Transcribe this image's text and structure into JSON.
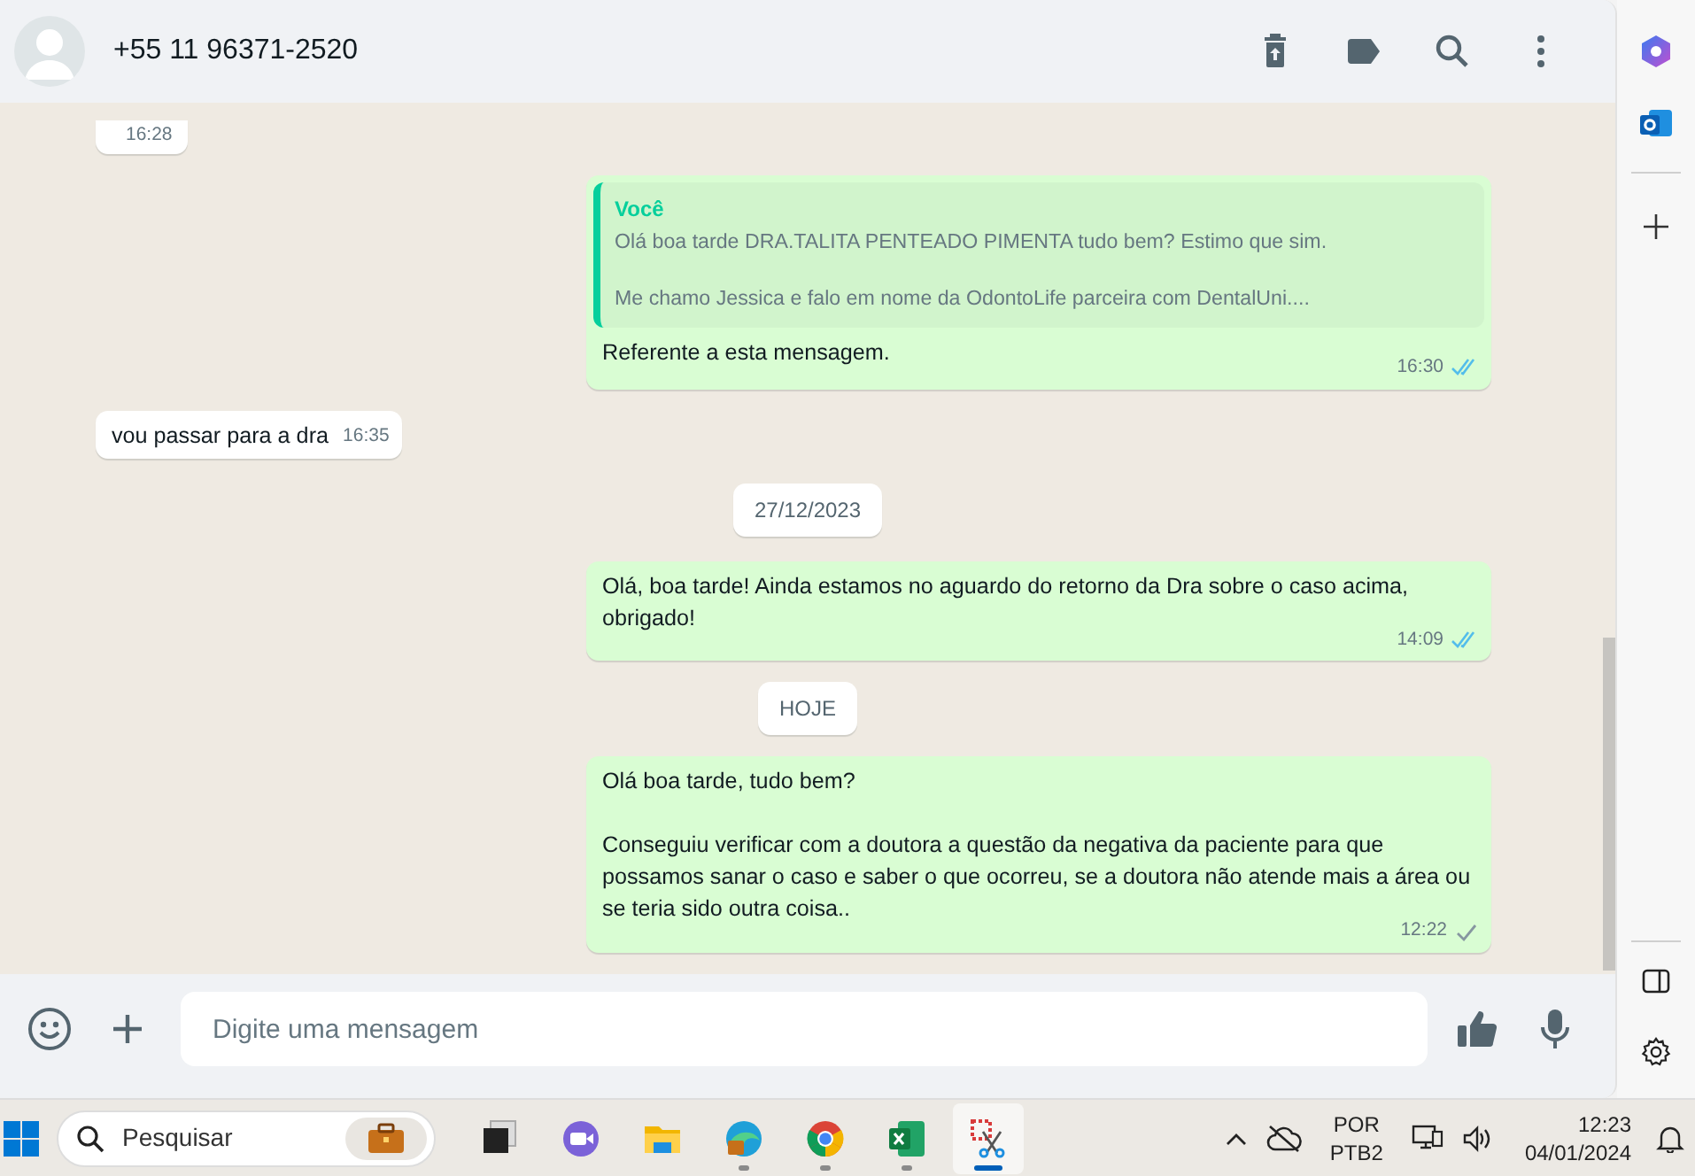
{
  "header": {
    "contact": "+55 11 96371-2520"
  },
  "messages": [
    {
      "kind": "incoming",
      "time": "16:28"
    },
    {
      "kind": "outgoing",
      "quote": {
        "author": "Você",
        "text": "Olá boa tarde DRA.TALITA PENTEADO PIMENTA tudo bem? Estimo que sim.\n\nMe chamo Jessica e falo em nome da OdontoLife parceira com DentalUni...."
      },
      "text": "Referente a esta mensagem.",
      "time": "16:30",
      "read": true
    },
    {
      "kind": "incoming",
      "text": "vou passar para a dra",
      "time": "16:35"
    },
    {
      "kind": "date",
      "text": "27/12/2023"
    },
    {
      "kind": "outgoing",
      "text": "Olá, boa tarde! Ainda estamos no aguardo do retorno da Dra sobre o caso acima, obrigado!",
      "time": "14:09",
      "read": true
    },
    {
      "kind": "date",
      "text": "HOJE"
    },
    {
      "kind": "outgoing",
      "text": "Olá boa tarde, tudo bem?\n\nConseguiu verificar com a doutora a questão da negativa da paciente para que possamos sanar o caso e saber o que ocorreu, se a doutora não atende mais a área ou se teria sido outra coisa..",
      "time": "12:22",
      "read": false
    }
  ],
  "composer": {
    "placeholder": "Digite uma mensagem"
  },
  "taskbar": {
    "search_placeholder": "Pesquisar",
    "apps": [
      {
        "kind": "taskview",
        "selected": false,
        "running": false
      },
      {
        "kind": "meet",
        "selected": false,
        "running": false
      },
      {
        "kind": "folder",
        "selected": false,
        "running": false
      },
      {
        "kind": "edge",
        "selected": false,
        "running": true
      },
      {
        "kind": "chrome",
        "selected": false,
        "running": true
      },
      {
        "kind": "excel",
        "selected": false,
        "running": true
      },
      {
        "kind": "snip",
        "selected": true,
        "running": true
      }
    ],
    "language": "POR",
    "layout": "PTB2",
    "time": "12:23",
    "date": "04/01/2024"
  }
}
